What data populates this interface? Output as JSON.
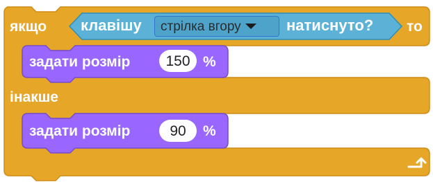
{
  "colors": {
    "control": "#e6a628",
    "control_edge": "#cf8b17",
    "sensing": "#5cb1d6",
    "sensing_edge": "#2e8eb8",
    "sensing_dropdown": "#4ea3cb",
    "looks": "#9966ff",
    "looks_edge": "#774dcb",
    "text": "#ffffff"
  },
  "if_else_block": {
    "if_label": "якщо",
    "then_label": "то",
    "else_label": "інакше",
    "return_icon": "return-arrow-icon"
  },
  "condition": {
    "prefix": "клавішу",
    "key_dropdown_value": "стрілка вгору",
    "dropdown_icon": "chevron-down-icon",
    "suffix": "натиснуто?"
  },
  "then_block": {
    "label": "задати розмір",
    "value": "150",
    "unit": "%"
  },
  "else_block": {
    "label": "задати розмір",
    "value": "90",
    "unit": "%"
  }
}
